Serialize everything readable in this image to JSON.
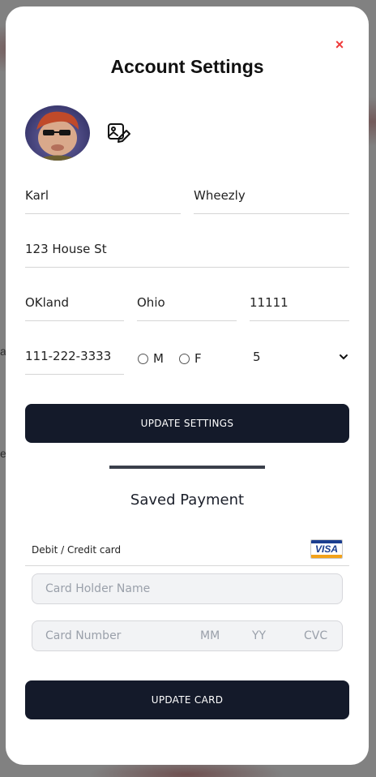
{
  "backdrop": {
    "left_fragments": [
      "a",
      "el"
    ]
  },
  "modal": {
    "title": "Account Settings",
    "close_symbol": "×",
    "profile": {
      "first_name": "Karl",
      "last_name": "Wheezly",
      "address": "123 House St",
      "city": "OKland",
      "state": "Ohio",
      "zip": "11111",
      "phone": "111-222-3333",
      "gender_options": [
        "M",
        "F"
      ],
      "select_value": "5",
      "update_label": "UPDATE SETTINGS"
    },
    "payment": {
      "title": "Saved Payment",
      "method_label": "Debit / Credit card",
      "card_brand": "VISA",
      "card_holder_placeholder": "Card Holder Name",
      "card_number_placeholder": "Card Number",
      "mm_placeholder": "MM",
      "yy_placeholder": "YY",
      "cvc_placeholder": "CVC",
      "update_label": "UPDATE CARD"
    }
  },
  "colors": {
    "accent_dark": "#141a2a",
    "close_red": "#ef3b3b",
    "visa_blue": "#1a3d8f",
    "visa_gold": "#f3a21a"
  },
  "icons": [
    "close-icon",
    "edit-image-icon",
    "chevron-down-icon",
    "visa-logo-icon"
  ]
}
